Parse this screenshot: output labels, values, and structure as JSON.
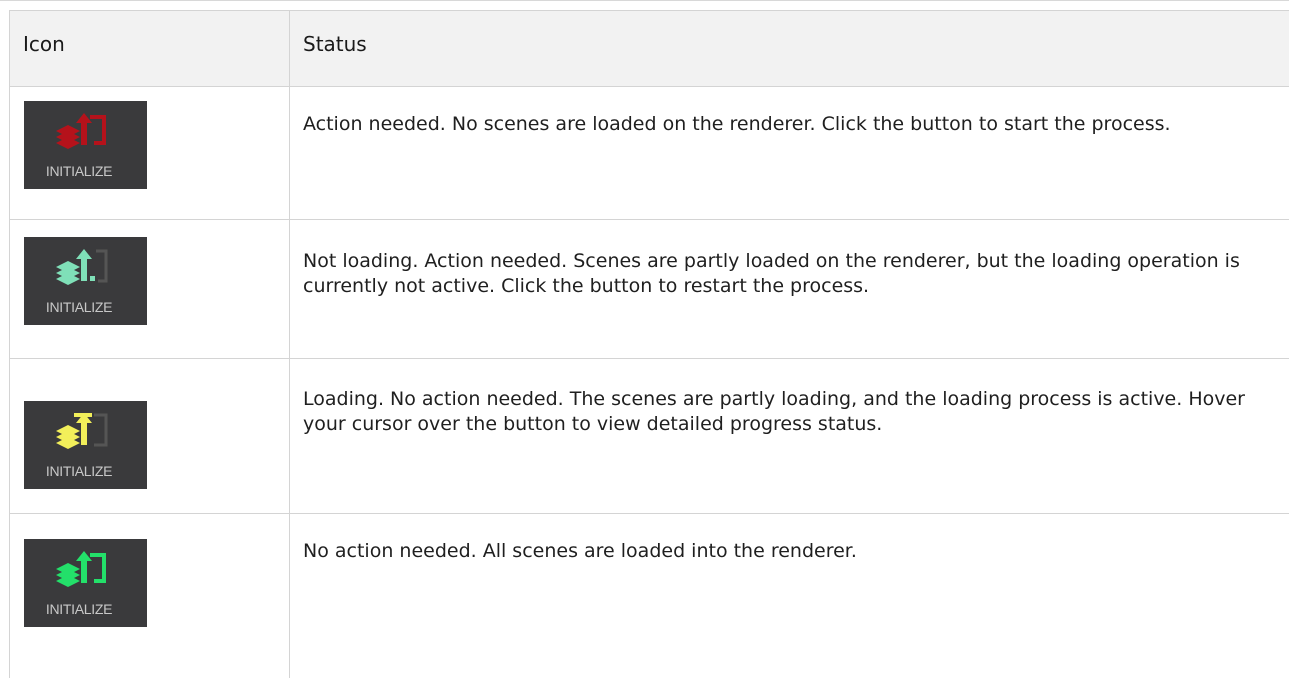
{
  "header": {
    "icon_col": "Icon",
    "status_col": "Status"
  },
  "rows": [
    {
      "icon_name": "initialize-red-icon",
      "icon_label": "INITIALIZE",
      "color": "#b5121b",
      "status": "Action needed. No scenes are loaded on the renderer. Click the button to start the process."
    },
    {
      "icon_name": "initialize-teal-icon",
      "icon_label": "INITIALIZE",
      "color": "#7fe0b8",
      "status": "Not loading. Action needed. Scenes are partly loaded on the renderer, but the loading operation is currently not active. Click the button to restart the process."
    },
    {
      "icon_name": "initialize-yellow-icon",
      "icon_label": "INITIALIZE",
      "color": "#f2ef5a",
      "status": "Loading. No action needed. The scenes are partly loading, and the loading process is active. Hover your cursor over the button to view detailed progress status."
    },
    {
      "icon_name": "initialize-green-icon",
      "icon_label": "INITIALIZE",
      "color": "#23e06a",
      "status": "No action needed. All scenes are loaded into the renderer."
    }
  ]
}
